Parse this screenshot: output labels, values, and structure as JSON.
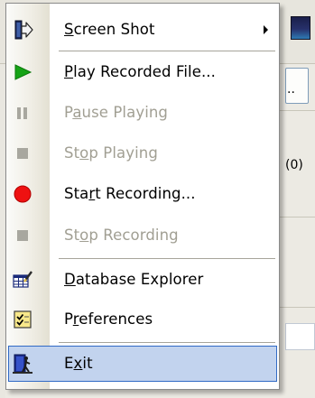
{
  "background": {
    "button_label": "..",
    "count_text": "(0)"
  },
  "menu": {
    "items": [
      {
        "label": "Screen Shot",
        "mnemonic": "S",
        "enabled": true,
        "has_submenu": true,
        "icon": "screenshot-icon"
      },
      {
        "label": "Play Recorded File...",
        "mnemonic": "P",
        "enabled": true,
        "icon": "play-icon"
      },
      {
        "label": "Pause Playing",
        "mnemonic": "a",
        "enabled": false,
        "icon": "pause-icon"
      },
      {
        "label": "Stop Playing",
        "mnemonic": "o",
        "enabled": false,
        "icon": "stop-icon"
      },
      {
        "label": "Start Recording...",
        "mnemonic": "r",
        "enabled": true,
        "icon": "record-icon"
      },
      {
        "label": "Stop Recording",
        "mnemonic": "o",
        "enabled": false,
        "icon": "stop-icon"
      },
      {
        "label": "Database Explorer",
        "mnemonic": "D",
        "enabled": true,
        "icon": "database-explorer-icon"
      },
      {
        "label": "Preferences",
        "mnemonic": "r",
        "enabled": true,
        "icon": "preferences-icon"
      },
      {
        "label": "Exit",
        "mnemonic": "x",
        "enabled": true,
        "selected": true,
        "icon": "exit-icon"
      }
    ]
  },
  "colors": {
    "selection_fill": "#c2d3ee",
    "selection_border": "#316ac5",
    "disabled_text": "#a19f93",
    "play_green": "#16a316",
    "record_red": "#ee1111"
  }
}
